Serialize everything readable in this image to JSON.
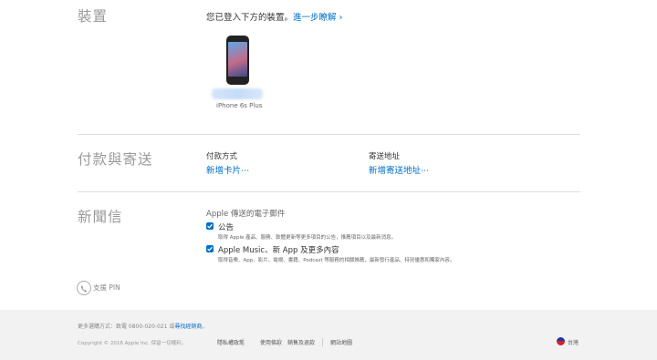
{
  "devices": {
    "title": "裝置",
    "intro": "您已登入下方的裝置。",
    "learn_more": "進一步瞭解",
    "device_model": "iPhone 6s Plus"
  },
  "payment": {
    "title": "付款與寄送",
    "pay_label": "付款方式",
    "add_card": "新增卡片⋯",
    "ship_label": "寄送地址",
    "add_address": "新增寄送地址⋯"
  },
  "newsletter": {
    "title": "新聞信",
    "heading": "Apple 傳送的電子郵件",
    "items": [
      {
        "label": "公告",
        "desc": "取得 Apple 產品、服務、軟體更新等更多項目的公告，推薦項目以及最新消息。",
        "checked": true
      },
      {
        "label": "Apple Music、新 App 及更多內容",
        "desc": "取得音樂、App、影片、電視、書籍、Podcast 等服務的相關推薦，最新發行產品、特別優惠和獨家內容。",
        "checked": true
      }
    ]
  },
  "support_pin": "支援 PIN",
  "footer": {
    "more_ways": "更多選購方式：致電 0800-020-021 或",
    "find_reseller": "尋找經銷商",
    "period": "。",
    "copyright": "Copyright © 2016 Apple Inc. 保留一切權利。",
    "links": [
      "隱私權政策",
      "使用條款",
      "銷售及退款",
      "網站地圖"
    ],
    "region": "台灣"
  },
  "colors": {
    "link": "#0070c9",
    "check": "#0070c9"
  }
}
